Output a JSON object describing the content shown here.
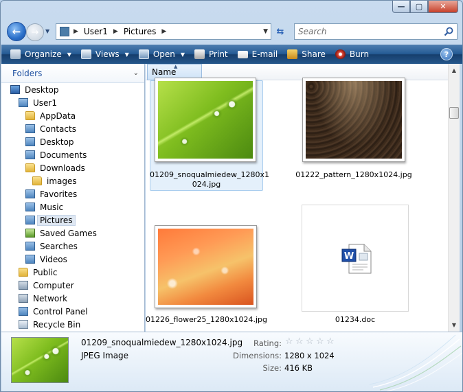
{
  "address": {
    "crumbs": [
      "User1",
      "Pictures"
    ],
    "search_placeholder": "Search"
  },
  "toolbar": {
    "organize": "Organize",
    "views": "Views",
    "open": "Open",
    "print": "Print",
    "email": "E-mail",
    "share": "Share",
    "burn": "Burn",
    "help": "?"
  },
  "nav": {
    "header": "Folders",
    "items": [
      {
        "label": "Desktop",
        "icon": "desktop-icon"
      },
      {
        "label": "User1",
        "icon": "user-folder-icon"
      },
      {
        "label": "AppData",
        "icon": "folder-icon"
      },
      {
        "label": "Contacts",
        "icon": "contacts-icon"
      },
      {
        "label": "Desktop",
        "icon": "desktop-folder-icon"
      },
      {
        "label": "Documents",
        "icon": "documents-icon"
      },
      {
        "label": "Downloads",
        "icon": "folder-icon"
      },
      {
        "label": "images",
        "icon": "folder-icon"
      },
      {
        "label": "Favorites",
        "icon": "favorites-icon"
      },
      {
        "label": "Music",
        "icon": "music-icon"
      },
      {
        "label": "Pictures",
        "icon": "pictures-icon"
      },
      {
        "label": "Saved Games",
        "icon": "saved-games-icon"
      },
      {
        "label": "Searches",
        "icon": "searches-icon"
      },
      {
        "label": "Videos",
        "icon": "videos-icon"
      },
      {
        "label": "Public",
        "icon": "folder-icon"
      },
      {
        "label": "Computer",
        "icon": "computer-icon"
      },
      {
        "label": "Network",
        "icon": "network-icon"
      },
      {
        "label": "Control Panel",
        "icon": "control-panel-icon"
      },
      {
        "label": "Recycle Bin",
        "icon": "recycle-bin-icon"
      }
    ]
  },
  "content": {
    "column_name": "Name",
    "files": [
      {
        "name_line1": "01209_snoqualmiedew_1280x1",
        "name_line2": "024.jpg",
        "kind": "leaf"
      },
      {
        "name_line1": "01222_pattern_1280x1024.jpg",
        "name_line2": "",
        "kind": "pattern"
      },
      {
        "name_line1": "01226_flower25_1280x1024.jpg",
        "name_line2": "",
        "kind": "flower"
      },
      {
        "name_line1": "01234.doc",
        "name_line2": "",
        "kind": "word-document"
      }
    ]
  },
  "details": {
    "file_name": "01209_snoqualmiedew_1280x1024.jpg",
    "file_type": "JPEG Image",
    "rating_label": "Rating:",
    "rating_stars": 0,
    "rating_max": 5,
    "dimensions_label": "Dimensions:",
    "dimensions_value": "1280 x 1024",
    "size_label": "Size:",
    "size_value": "416 KB"
  }
}
